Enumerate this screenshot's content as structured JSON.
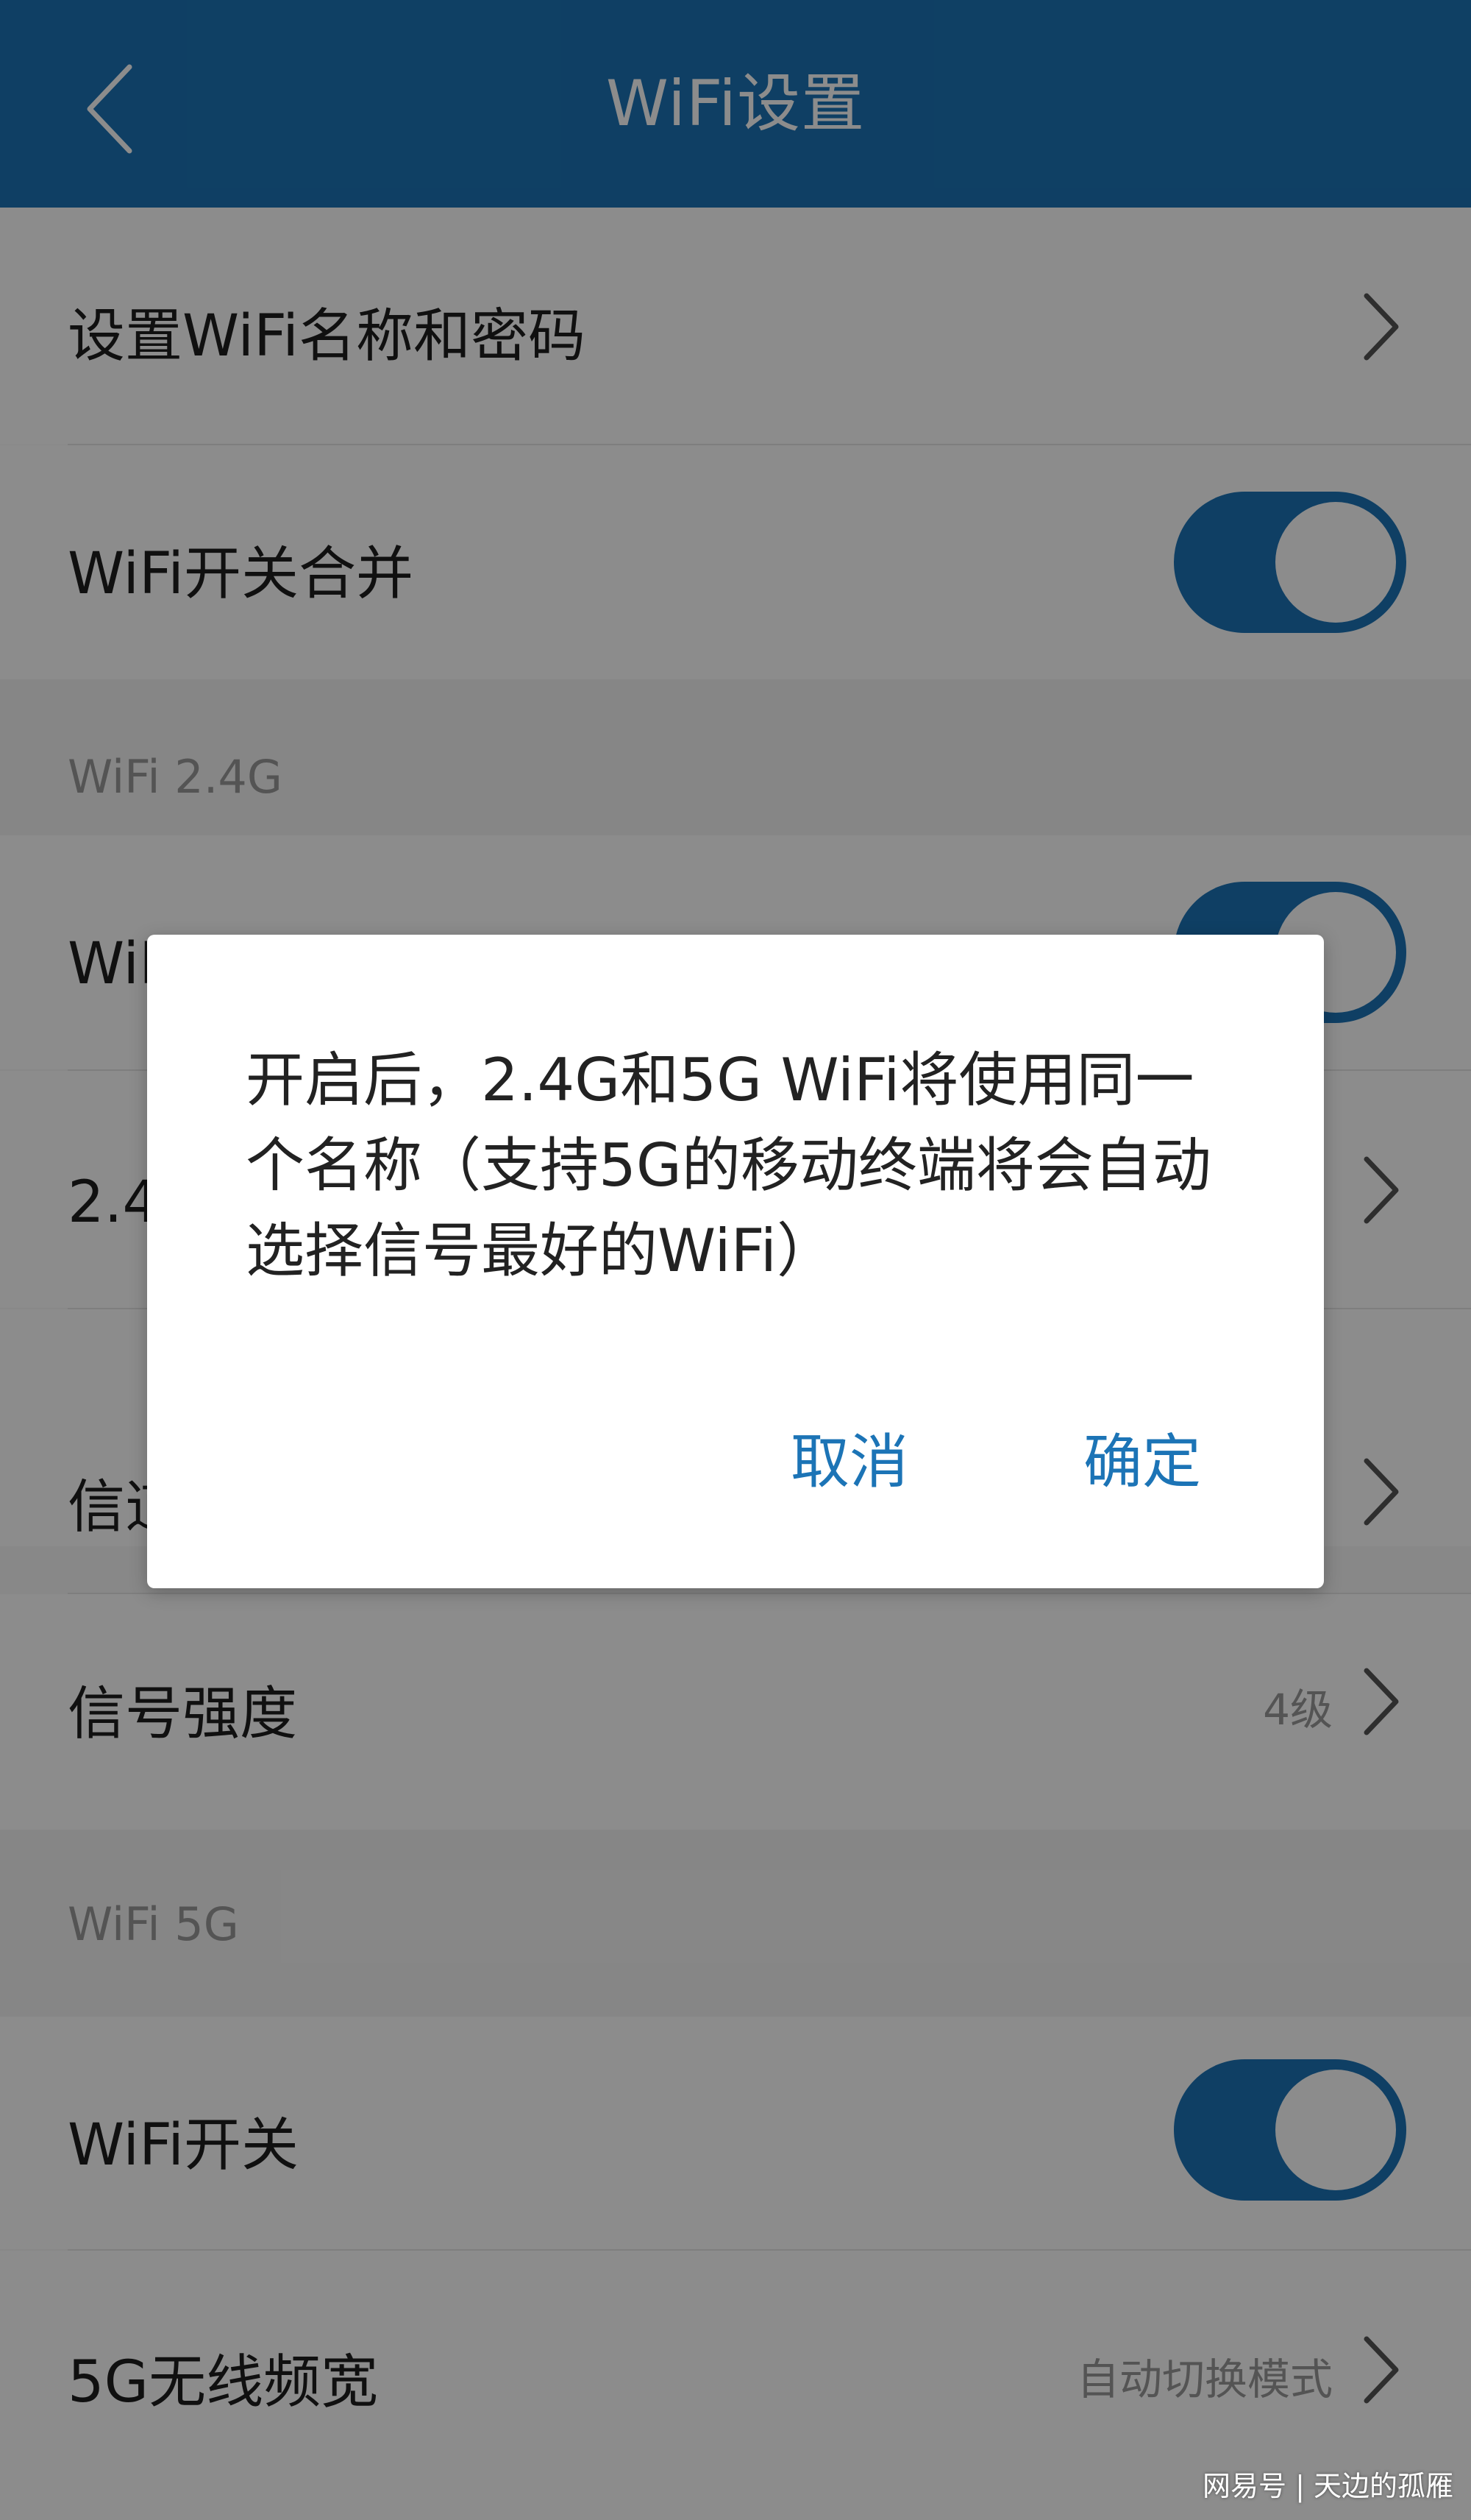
{
  "header": {
    "title": "WiFi设置"
  },
  "rows": {
    "set_name_password": {
      "label": "设置WiFi名称和密码"
    },
    "merge_switch": {
      "label": "WiFi开关合并",
      "on": true
    },
    "wifi24_switch": {
      "label": "WiFi开关",
      "on": true
    },
    "wifi24_bandwidth": {
      "label": "2.4G无线频宽"
    },
    "wifi24_channel": {
      "label": "信道"
    },
    "wifi24_signal": {
      "label": "信号强度",
      "value": "4级"
    },
    "wifi5_switch": {
      "label": "WiFi开关",
      "on": true
    },
    "wifi5_bandwidth": {
      "label": "5G无线频宽",
      "value": "自动切换模式"
    }
  },
  "sections": {
    "wifi24": "WiFi 2.4G",
    "wifi5": "WiFi 5G"
  },
  "dialog": {
    "message": "开启后，2.4G和5G WiFi将使用同一个名称（支持5G的移动终端将会自动选择信号最好的WiFi）",
    "cancel_label": "取消",
    "confirm_label": "确定"
  },
  "watermark": "网易号 | 天边的孤雁",
  "colors": {
    "accent": "#1c74b6",
    "toggle_on": "#1c74b6"
  },
  "icons": {
    "back": "chevron-left-icon",
    "row_arrow": "chevron-right-icon"
  }
}
